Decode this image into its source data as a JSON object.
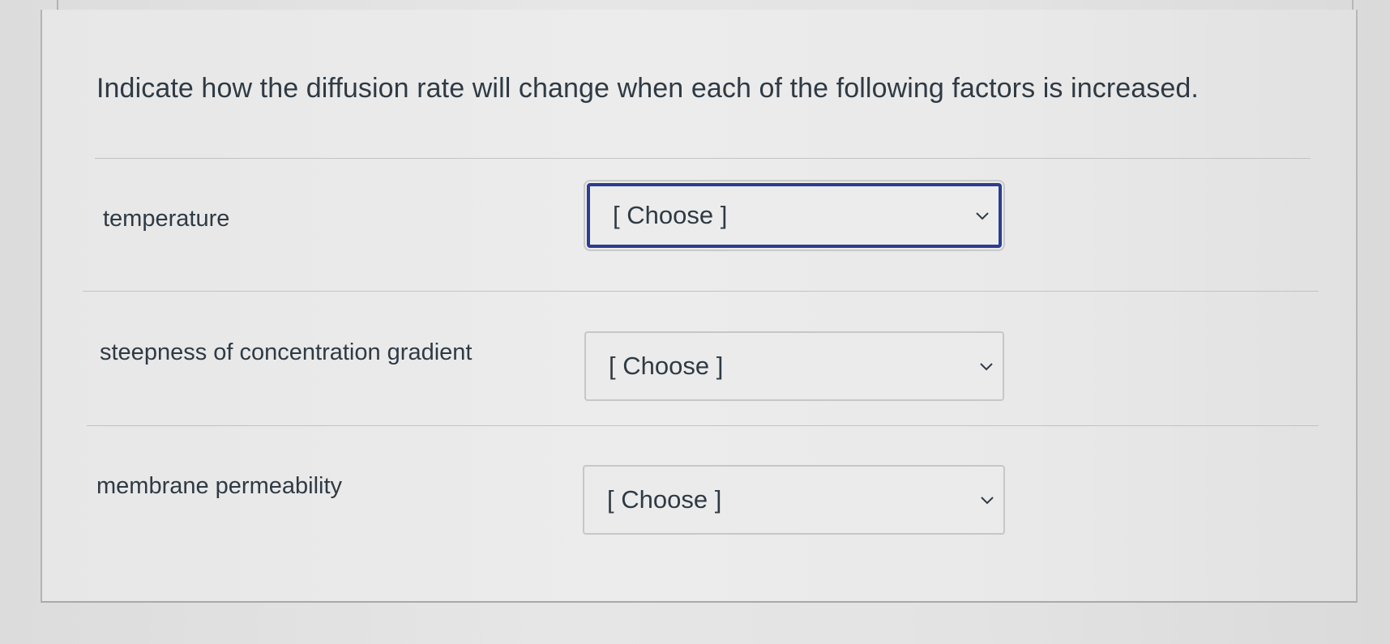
{
  "question": {
    "prompt": "Indicate how the diffusion rate will change when each of the following factors is increased."
  },
  "rows": [
    {
      "label": "temperature",
      "selected": "[ Choose ]"
    },
    {
      "label": "steepness of concentration gradient",
      "selected": "[ Choose ]"
    },
    {
      "label": "membrane permeability",
      "selected": "[ Choose ]"
    }
  ],
  "icons": {
    "dropdown": "chevron-down-icon"
  },
  "colors": {
    "focus_border": "#2c3c8f",
    "text": "#2f3a44"
  }
}
